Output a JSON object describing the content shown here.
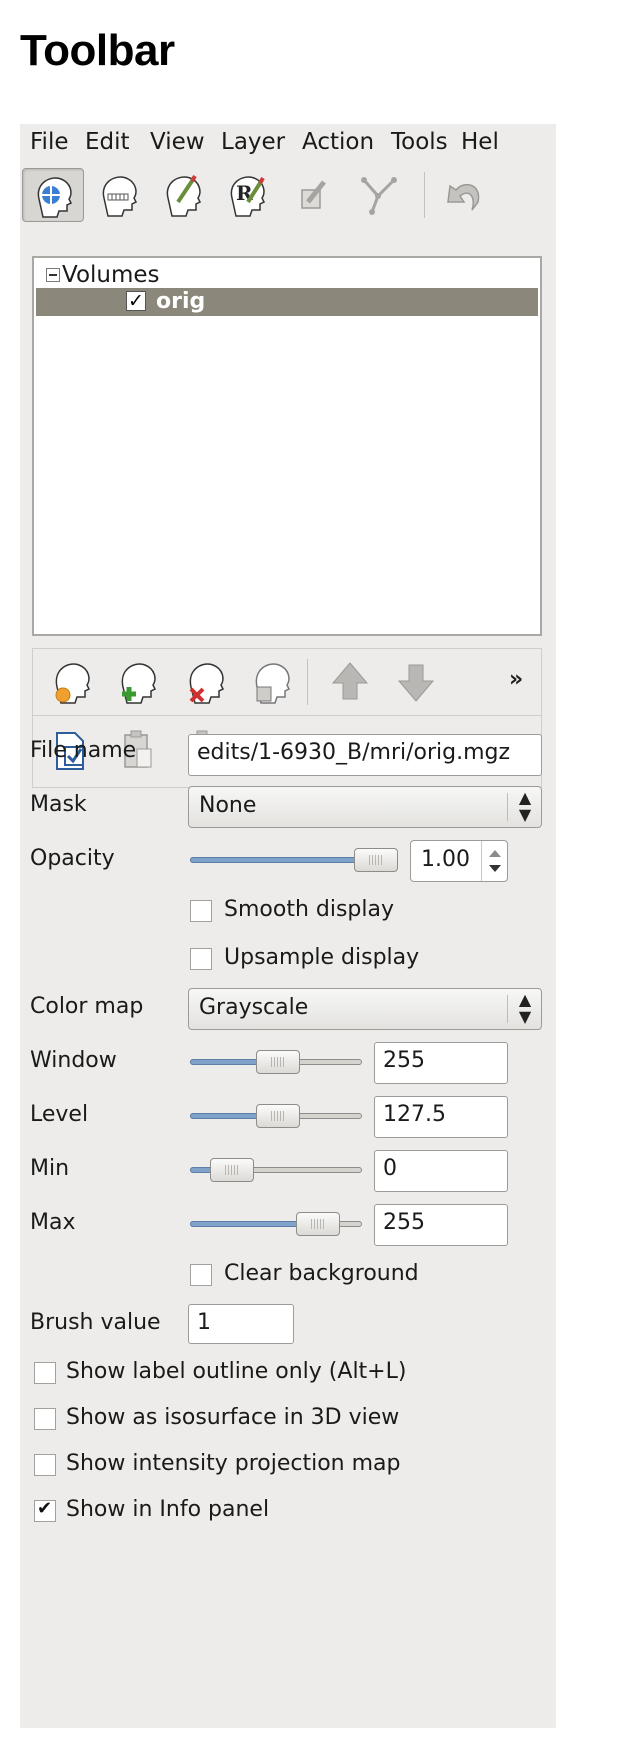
{
  "page": {
    "title": "Toolbar"
  },
  "menubar": {
    "items": [
      "File",
      "Edit",
      "View",
      "Layer",
      "Action",
      "Tools",
      "Hel"
    ]
  },
  "toolbar": {
    "buttons": [
      "navigate",
      "voxel-edit",
      "recon-edit",
      "roi-edit",
      "point-set-edit",
      "contour",
      "undo"
    ],
    "active": "navigate"
  },
  "layers": {
    "root_label": "Volumes",
    "items": [
      {
        "label": "orig",
        "checked": true,
        "selected": true
      }
    ]
  },
  "layer_toolbar": {
    "more_label": "»",
    "row1": [
      "load-volume",
      "new-volume",
      "close-volume",
      "save-volume",
      "move-up",
      "move-down"
    ],
    "row2": [
      "lock-layer",
      "copy-setting",
      "paste-setting"
    ]
  },
  "properties": {
    "file_name_label": "File name",
    "file_name_value": "edits/1-6930_B/mri/orig.mgz",
    "mask_label": "Mask",
    "mask_value": "None",
    "opacity_label": "Opacity",
    "opacity_value": "1.00",
    "opacity_level": 1.0,
    "smooth_display_label": "Smooth display",
    "smooth_display_checked": false,
    "upsample_display_label": "Upsample display",
    "upsample_display_checked": false,
    "color_map_label": "Color map",
    "color_map_value": "Grayscale",
    "window_label": "Window",
    "window_value": "255",
    "level_label": "Level",
    "level_value": "127.5",
    "min_label": "Min",
    "min_value": "0",
    "max_label": "Max",
    "max_value": "255",
    "clear_background_label": "Clear background",
    "clear_background_checked": false,
    "brush_value_label": "Brush value",
    "brush_value": "1"
  },
  "options": [
    {
      "label": "Show label outline only (Alt+L)",
      "checked": false
    },
    {
      "label": "Show as isosurface in 3D view",
      "checked": false
    },
    {
      "label": "Show intensity projection map",
      "checked": false
    },
    {
      "label": "Show in Info panel",
      "checked": true
    }
  ],
  "colors": {
    "panel_bg": "#edecea",
    "selection": "#8c877b",
    "slider_fill": "#7ea2c9"
  }
}
